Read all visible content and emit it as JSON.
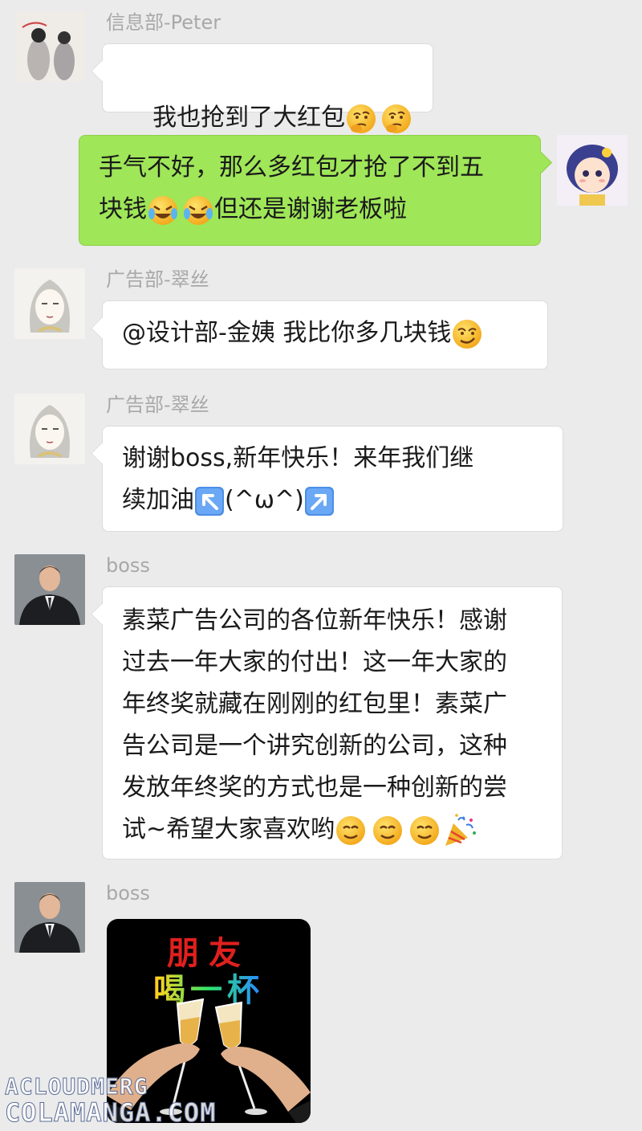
{
  "messages": [
    {
      "sender": "信息部-Peter",
      "text": "我也抢到了大红包"
    },
    {
      "text_line1": "手气不好，那么多红包才抢了不到五",
      "text_line2": "块钱",
      "text_line2b": "但还是谢谢老板啦"
    },
    {
      "sender": "广告部-翠丝",
      "text": "@设计部-金姨 我比你多几块钱"
    },
    {
      "sender": "广告部-翠丝",
      "text_line1": "谢谢boss,新年快乐！来年我们继",
      "text_line2a": "续加油",
      "text_line2b": "(^ω^)"
    },
    {
      "sender": "boss",
      "lines": [
        "素菜广告公司的各位新年快乐！感谢",
        "过去一年大家的付出！这一年大家的",
        "年终奖就藏在刚刚的红包里！素菜广",
        "告公司是一个讲究创新的公司，这种",
        "发放年终奖的方式也是一种创新的尝",
        "试~希望大家喜欢哟"
      ]
    },
    {
      "sender": "boss",
      "sticker_line1": "朋友",
      "sticker_line2": "喝一杯"
    }
  ],
  "watermark": {
    "line1": "ACLOUDMERG",
    "line2": "COLAMANGA.COM"
  },
  "icons": [
    "thinking-face-icon",
    "tears-of-joy-icon",
    "smirk-face-icon",
    "arrow-upper-left-icon",
    "arrow-upper-right-icon",
    "smile-face-icon",
    "party-popper-icon"
  ],
  "colors": {
    "background": "#ebebeb",
    "incoming_bubble": "#ffffff",
    "outgoing_bubble": "#9fe658",
    "sender_text": "#a8a8a8"
  }
}
